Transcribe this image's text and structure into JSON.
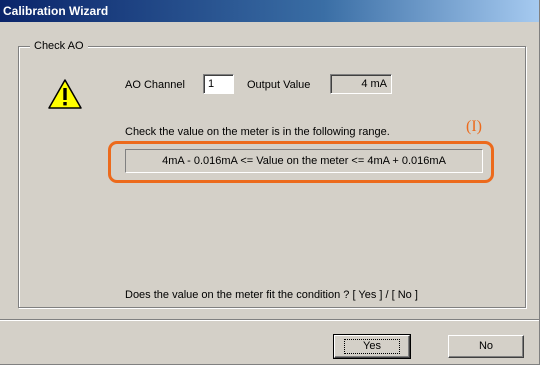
{
  "window": {
    "title": "Calibration Wizard"
  },
  "group": {
    "legend": "Check AO"
  },
  "ao": {
    "channel_label": "AO Channel",
    "channel_value": "1",
    "output_label": "Output Value",
    "output_value": "4 mA"
  },
  "instruction": "Check the value on the meter is in the following range.",
  "range_text": "4mA - 0.016mA <=  Value on the meter  <= 4mA + 0.016mA",
  "annotation": "(I)",
  "question": "Does the value on the meter fit the condition ? [ Yes ] / [ No ]",
  "buttons": {
    "yes": "Yes",
    "no": "No"
  },
  "colors": {
    "highlight": "#ec6a1c",
    "title_bar": "#0a246a",
    "face": "#d4d0c8"
  },
  "icons": {
    "warning": "warning-icon"
  }
}
